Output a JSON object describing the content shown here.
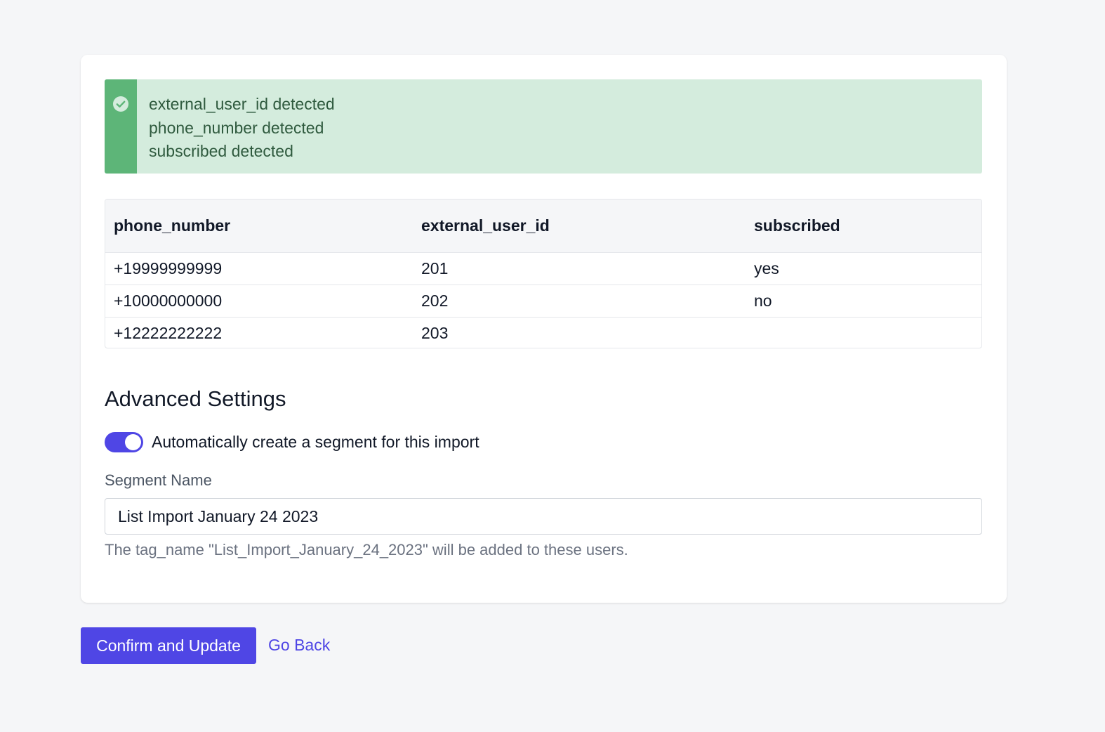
{
  "alert": {
    "lines": [
      "external_user_id detected",
      "phone_number detected",
      "subscribed detected"
    ],
    "icon": "check-circle-icon",
    "bar_color": "#5db578",
    "background": "#d4ecdd"
  },
  "table": {
    "headers": [
      "phone_number",
      "external_user_id",
      "subscribed"
    ],
    "rows": [
      [
        "+19999999999",
        "201",
        "yes"
      ],
      [
        "+10000000000",
        "202",
        "no"
      ],
      [
        "+12222222222",
        "203",
        ""
      ]
    ]
  },
  "advanced": {
    "title": "Advanced Settings",
    "toggle_label": "Automatically create a segment for this import",
    "toggle_on": true,
    "segment_label": "Segment Name",
    "segment_value": "List Import January 24 2023",
    "help_text": "The tag_name \"List_Import_January_24_2023\" will be added to these users."
  },
  "actions": {
    "confirm_label": "Confirm and Update",
    "back_label": "Go Back"
  },
  "colors": {
    "accent": "#4f46e5"
  }
}
